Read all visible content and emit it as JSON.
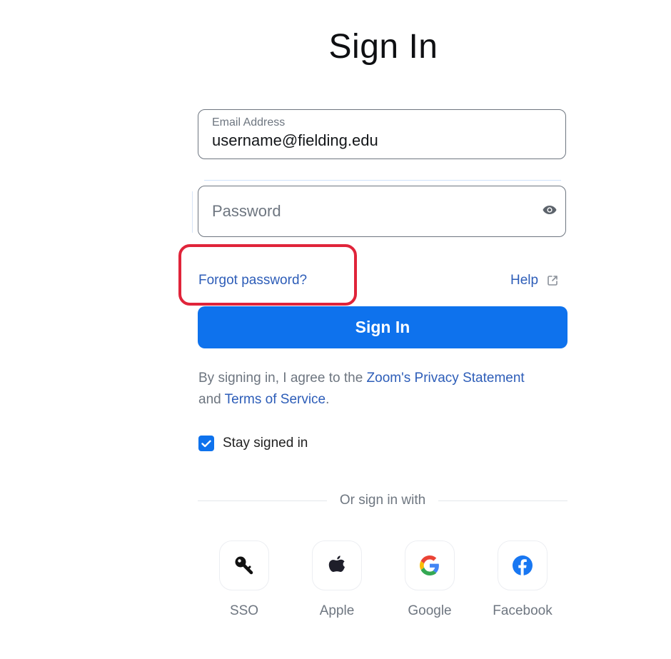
{
  "page": {
    "title": "Sign In"
  },
  "email": {
    "label": "Email Address",
    "value": "username@fielding.edu"
  },
  "password": {
    "placeholder": "Password",
    "value": "",
    "toggle_icon": "eye-icon"
  },
  "links": {
    "forgot_password": "Forgot password?",
    "help": "Help",
    "help_icon": "external-link-icon"
  },
  "signin_button": {
    "label": "Sign In"
  },
  "agreement": {
    "prefix": "By signing in, I agree to the ",
    "privacy_link": "Zoom's Privacy Statement",
    "middle": " and ",
    "terms_link": "Terms of Service",
    "suffix": "."
  },
  "stay_signed_in": {
    "label": "Stay signed in",
    "checked": true
  },
  "alt_signin": {
    "divider_text": "Or sign in with",
    "providers": [
      {
        "label": "SSO",
        "icon": "key-icon"
      },
      {
        "label": "Apple",
        "icon": "apple-icon"
      },
      {
        "label": "Google",
        "icon": "google-icon"
      },
      {
        "label": "Facebook",
        "icon": "facebook-icon"
      }
    ]
  },
  "colors": {
    "primary": "#0e72ed",
    "link": "#2d5db8",
    "highlight": "#e0243a",
    "muted_text": "#6e7680"
  }
}
